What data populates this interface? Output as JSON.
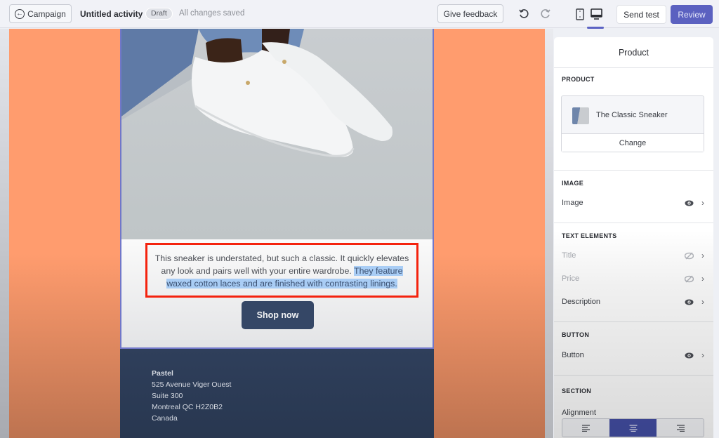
{
  "topbar": {
    "back_label": "Campaign",
    "back_icon": "arrow-left-circle-icon",
    "title": "Untitled activity",
    "status_badge": "Draft",
    "save_status": "All changes saved",
    "feedback_label": "Give feedback",
    "undo_icon": "undo-icon",
    "redo_icon": "redo-icon",
    "preview_modes": [
      {
        "name": "mobile",
        "icon": "mobile-icon",
        "active": false
      },
      {
        "name": "desktop",
        "icon": "desktop-icon",
        "active": true
      }
    ],
    "send_test_label": "Send test",
    "review_label": "Review"
  },
  "email": {
    "hero_image": "white-sneakers-photo",
    "description_plain": "This sneaker is understated, but such a classic. It quickly elevates any look and pairs well with your entire wardrobe.",
    "description_selected": "They feature waxed cotton laces and are finished with contrasting linings.",
    "cta_label": "Shop now",
    "footer": {
      "company": "Pastel",
      "address_lines": [
        "525 Avenue Viger Ouest",
        "Suite 300",
        "Montreal QC H2Z0B2",
        "Canada"
      ]
    }
  },
  "panel": {
    "title": "Product",
    "product_section": {
      "label": "PRODUCT",
      "product_name": "The Classic Sneaker",
      "change_label": "Change"
    },
    "image_section": {
      "label": "IMAGE",
      "rows": [
        {
          "label": "Image",
          "visible": true
        }
      ]
    },
    "text_section": {
      "label": "TEXT ELEMENTS",
      "rows": [
        {
          "label": "Title",
          "visible": false
        },
        {
          "label": "Price",
          "visible": false
        },
        {
          "label": "Description",
          "visible": true
        }
      ]
    },
    "button_section": {
      "label": "BUTTON",
      "rows": [
        {
          "label": "Button",
          "visible": true
        }
      ]
    },
    "layout_section": {
      "label": "SECTION",
      "alignment_label": "Alignment",
      "alignment_options": [
        "left",
        "center",
        "right"
      ],
      "alignment_selected": "center"
    }
  },
  "colors": {
    "accent": "#5b61c0",
    "canvas_bg": "#ff9c6e",
    "highlight_box": "#f4230e",
    "cta_bg": "#354766",
    "footer_bg": "#2f3f5b",
    "selection": "#a9cdf5"
  }
}
